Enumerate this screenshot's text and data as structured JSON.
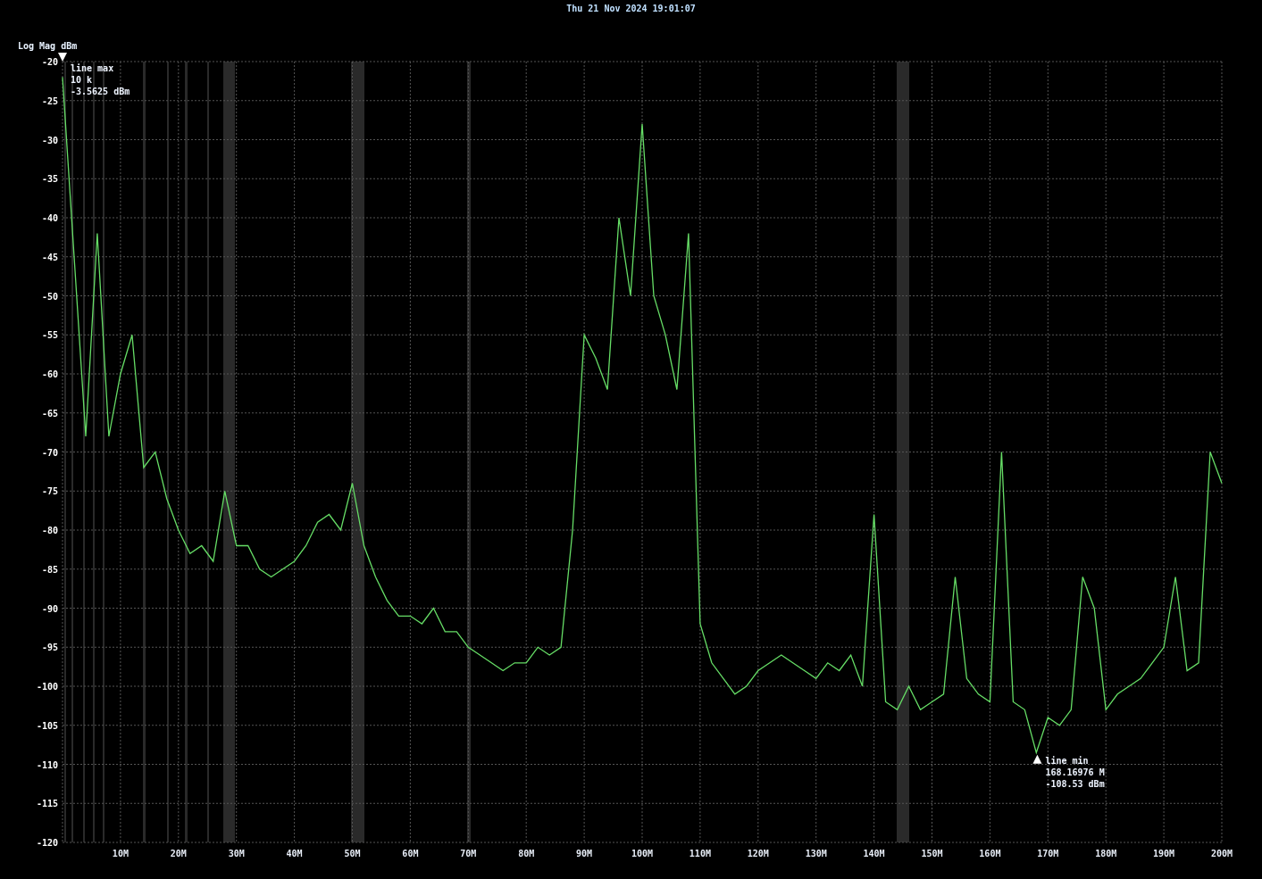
{
  "header": {
    "datetime": "Thu 21 Nov 2024 19:01:07"
  },
  "plot": {
    "y_axis_label": "Log Mag dBm",
    "chart_data": {
      "type": "line",
      "xlim": [
        0,
        200
      ],
      "ylim": [
        -120,
        -20
      ],
      "xticks": [
        {
          "value": 10,
          "label": "10M"
        },
        {
          "value": 20,
          "label": "20M"
        },
        {
          "value": 30,
          "label": "30M"
        },
        {
          "value": 40,
          "label": "40M"
        },
        {
          "value": 50,
          "label": "50M"
        },
        {
          "value": 60,
          "label": "60M"
        },
        {
          "value": 70,
          "label": "70M"
        },
        {
          "value": 80,
          "label": "80M"
        },
        {
          "value": 90,
          "label": "90M"
        },
        {
          "value": 100,
          "label": "100M"
        },
        {
          "value": 110,
          "label": "110M"
        },
        {
          "value": 120,
          "label": "120M"
        },
        {
          "value": 130,
          "label": "130M"
        },
        {
          "value": 140,
          "label": "140M"
        },
        {
          "value": 150,
          "label": "150M"
        },
        {
          "value": 160,
          "label": "160M"
        },
        {
          "value": 170,
          "label": "170M"
        },
        {
          "value": 180,
          "label": "180M"
        },
        {
          "value": 190,
          "label": "190M"
        },
        {
          "value": 200,
          "label": "200M"
        }
      ],
      "yticks": [
        -20,
        -25,
        -30,
        -35,
        -40,
        -45,
        -50,
        -55,
        -60,
        -65,
        -70,
        -75,
        -80,
        -85,
        -90,
        -95,
        -100,
        -105,
        -110,
        -115,
        -120
      ],
      "x": [
        0,
        2,
        4,
        6,
        8,
        10,
        12,
        14,
        16,
        18,
        20,
        22,
        24,
        26,
        28,
        30,
        32,
        34,
        36,
        38,
        40,
        42,
        44,
        46,
        48,
        50,
        52,
        54,
        56,
        58,
        60,
        62,
        64,
        66,
        68,
        70,
        72,
        74,
        76,
        78,
        80,
        82,
        84,
        86,
        88,
        90,
        92,
        94,
        96,
        98,
        100,
        102,
        104,
        106,
        108,
        110,
        112,
        114,
        116,
        118,
        120,
        122,
        124,
        126,
        128,
        130,
        132,
        134,
        136,
        138,
        140,
        142,
        144,
        146,
        148,
        150,
        152,
        154,
        156,
        158,
        160,
        162,
        164,
        166,
        168,
        170,
        172,
        174,
        176,
        178,
        180,
        182,
        184,
        186,
        188,
        190,
        192,
        194,
        196,
        198,
        200
      ],
      "series": [
        {
          "color": "#66dd66",
          "values": [
            -22,
            -45,
            -68,
            -42,
            -68,
            -60,
            -55,
            -72,
            -70,
            -76,
            -80,
            -83,
            -82,
            -84,
            -75,
            -82,
            -82,
            -85,
            -86,
            -85,
            -84,
            -82,
            -79,
            -78,
            -80,
            -74,
            -82,
            -86,
            -89,
            -91,
            -91,
            -92,
            -90,
            -93,
            -93,
            -95,
            -96,
            -97,
            -98,
            -97,
            -97,
            -95,
            -96,
            -95,
            -80,
            -55,
            -58,
            -62,
            -40,
            -50,
            -28,
            -50,
            -55,
            -62,
            -42,
            -92,
            -97,
            -99,
            -101,
            -100,
            -98,
            -97,
            -96,
            -97,
            -98,
            -99,
            -97,
            -98,
            -96,
            -100,
            -78,
            -102,
            -103,
            -100,
            -103,
            -102,
            -101,
            -86,
            -99,
            -101,
            -102,
            -70,
            -102,
            -103,
            -108.5,
            -104,
            -105,
            -103,
            -86,
            -90,
            -103,
            -101,
            -100,
            -99,
            -97,
            -95,
            -86,
            -98,
            -97,
            -70,
            -74
          ]
        }
      ],
      "grid": true,
      "annotations": [
        "line max\n10 k\n-3.5625 dBm",
        {
          "x": 168.17,
          "y": -108.53,
          "text": "line min\n168.16976 M\n-108.53 dBm"
        }
      ]
    }
  }
}
